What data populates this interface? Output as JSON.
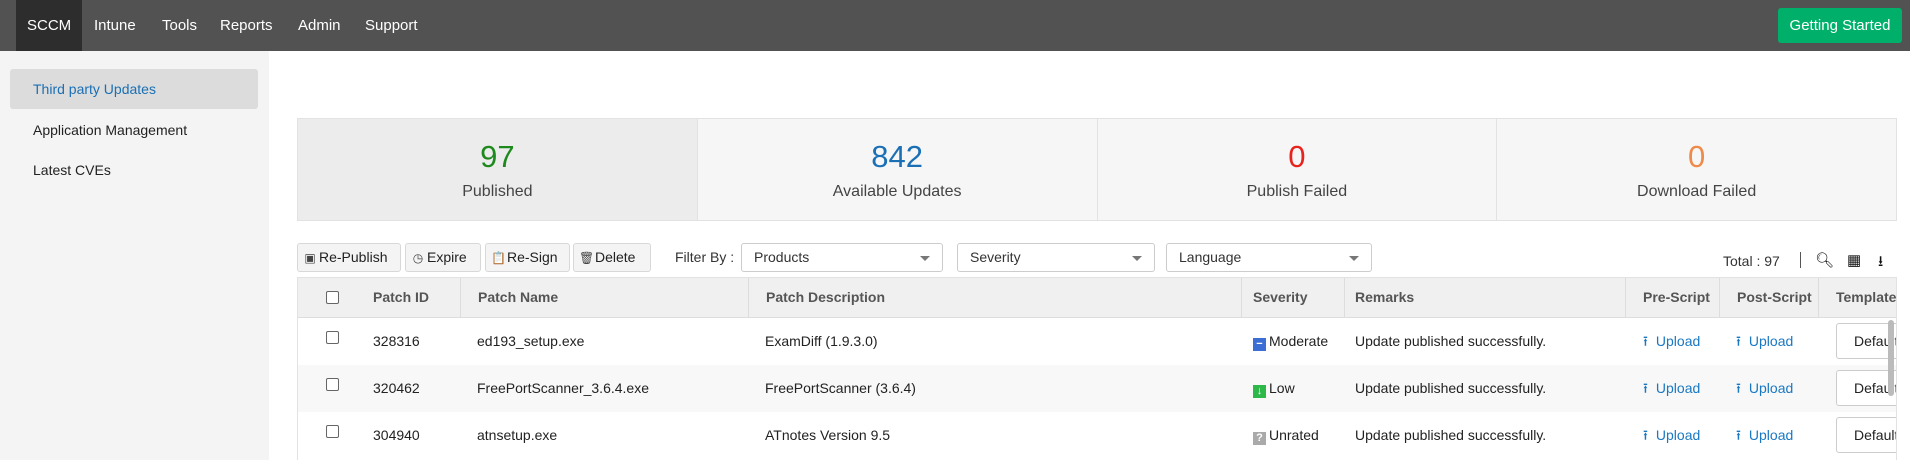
{
  "nav": {
    "items": [
      "SCCM",
      "Intune",
      "Tools",
      "Reports",
      "Admin",
      "Support"
    ],
    "active": "SCCM",
    "getting_started": "Getting Started"
  },
  "sidebar": {
    "items": [
      {
        "label": "Third party Updates",
        "active": true
      },
      {
        "label": "Application Management"
      },
      {
        "label": "Latest CVEs"
      }
    ]
  },
  "stats": [
    {
      "value": "97",
      "label": "Published",
      "color": "#1e8a1e"
    },
    {
      "value": "842",
      "label": "Available Updates",
      "color": "#1a6fb5"
    },
    {
      "value": "0",
      "label": "Publish Failed",
      "color": "#e8231c"
    },
    {
      "value": "0",
      "label": "Download Failed",
      "color": "#ef8b4a"
    }
  ],
  "toolbar": {
    "republish": "Re-Publish",
    "expire": "Expire",
    "resign": "Re-Sign",
    "delete": "Delete",
    "filter_by": "Filter By :",
    "products": "Products",
    "severity": "Severity",
    "language": "Language",
    "total": "Total : 97"
  },
  "table": {
    "headers": [
      "Patch ID",
      "Patch Name",
      "Patch Description",
      "Severity",
      "Remarks",
      "Pre-Script",
      "Post-Script",
      "Template"
    ],
    "rows": [
      {
        "id": "328316",
        "name": "ed193_setup.exe",
        "desc": "ExamDiff (1.9.3.0)",
        "severity": "Moderate",
        "sev_color": "#3b6fd4",
        "sev_icon": "minus",
        "remarks": "Update published successfully.",
        "pre": "Upload",
        "post": "Upload",
        "template": "Default"
      },
      {
        "id": "320462",
        "name": "FreePortScanner_3.6.4.exe",
        "desc": "FreePortScanner (3.6.4)",
        "severity": "Low",
        "sev_color": "#2fb84a",
        "sev_icon": "arrow-down",
        "remarks": "Update published successfully.",
        "pre": "Upload",
        "post": "Upload",
        "template": "Default"
      },
      {
        "id": "304940",
        "name": "atnsetup.exe",
        "desc": "ATnotes Version 9.5",
        "severity": "Unrated",
        "sev_color": "#aaaaaa",
        "sev_icon": "question",
        "remarks": "Update published successfully.",
        "pre": "Upload",
        "post": "Upload",
        "template": "Default"
      }
    ]
  }
}
